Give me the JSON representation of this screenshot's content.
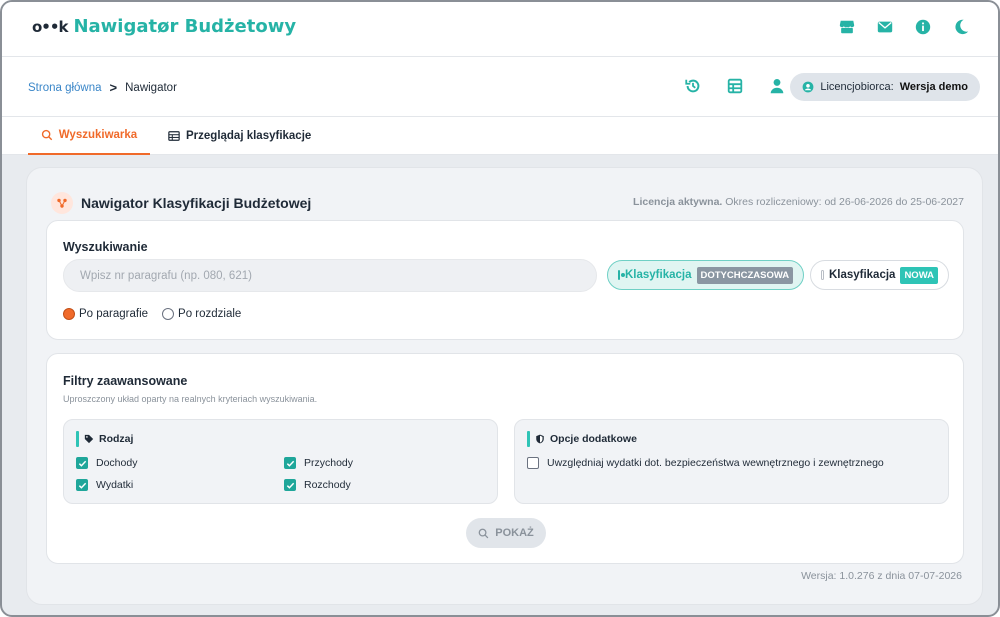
{
  "header": {
    "logo_text": "o••k",
    "app_title": "Nawigatør Budżetowy",
    "icons": [
      "store-icon",
      "mail-icon",
      "info-icon",
      "moon-icon"
    ],
    "accent_color": "#26b3a6"
  },
  "breadcrumb": {
    "home": "Strona główna",
    "separator": ">",
    "current": "Nawigator"
  },
  "toolbar": {
    "icons": [
      "history-icon",
      "table-icon",
      "user-icon"
    ],
    "licensee_label": "Licencjobiorca:",
    "licensee_value": "Wersja demo"
  },
  "tabs": [
    {
      "label": "Wyszukiwarka",
      "active": true
    },
    {
      "label": "Przeglądaj klasyfikacje",
      "active": false
    }
  ],
  "card": {
    "title": "Nawigator Klasyfikacji Budżetowej",
    "license_status": "Licencja aktywna.",
    "license_period": "Okres rozliczeniowy: od 26-06-2026 do 25-06-2027"
  },
  "search": {
    "title": "Wyszukiwanie",
    "placeholder": "Wpisz nr paragrafu (np. 080, 621)",
    "value": "",
    "classification_old_label": "Klasyfikacja",
    "classification_old_badge": "DOTYCHCZASOWA",
    "classification_new_label": "Klasyfikacja",
    "classification_new_badge": "NOWA",
    "selected_classification": "DOTYCHCZASOWA",
    "mode_options": [
      "Po paragrafie",
      "Po rozdziale"
    ],
    "selected_mode": "Po paragrafie"
  },
  "filters": {
    "title": "Filtry zaawansowane",
    "subtitle": "Uproszczony układ oparty na realnych kryteriach wyszukiwania.",
    "type_group_title": "Rodzaj",
    "type_options": [
      {
        "label": "Dochody",
        "checked": true
      },
      {
        "label": "Przychody",
        "checked": true
      },
      {
        "label": "Wydatki",
        "checked": true
      },
      {
        "label": "Rozchody",
        "checked": true
      }
    ],
    "extra_group_title": "Opcje dodatkowe",
    "extra_options": [
      {
        "label": "Uwzględniaj wydatki dot. bezpieczeństwa wewnętrznego i zewnętrznego",
        "checked": false
      }
    ],
    "show_button": "POKAŻ"
  },
  "footer": {
    "version": "Wersja: 1.0.276 z dnia 07-07-2026"
  }
}
